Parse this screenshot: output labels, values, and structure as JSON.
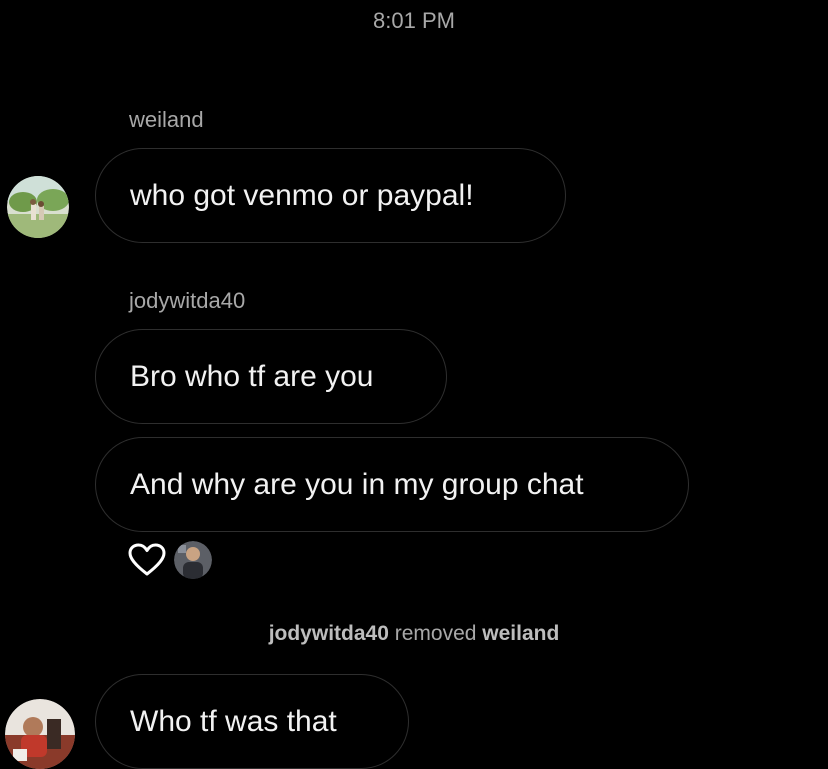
{
  "status": {
    "time": "8:01 PM"
  },
  "messages": [
    {
      "sender": "weiland",
      "text": "who got venmo or paypal!"
    },
    {
      "sender": "jodywitda40",
      "text": "Bro who tf are you"
    },
    {
      "text": "And why are you in my group chat"
    },
    {
      "text": "Who tf was that"
    }
  ],
  "system": {
    "actor": "jodywitda40",
    "action": "removed",
    "target": "weiland"
  },
  "icons": {
    "reaction": "heart-outline-icon",
    "accent": "#a8a8a8"
  }
}
